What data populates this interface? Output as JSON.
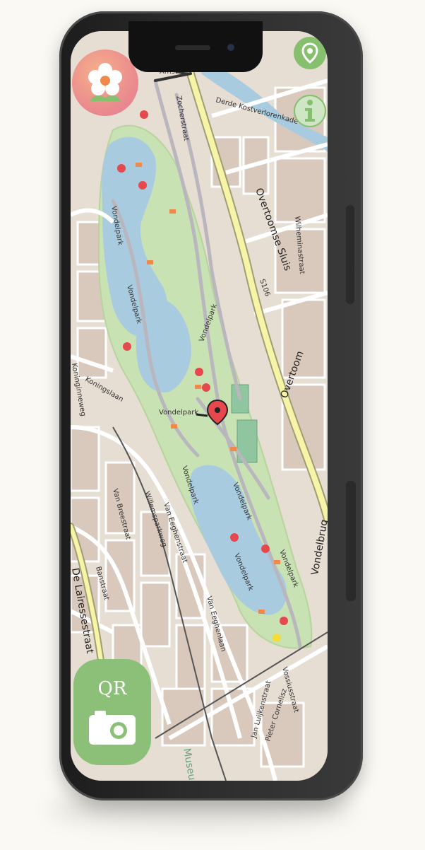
{
  "map": {
    "park_name": "Vondelpark",
    "labels": [
      {
        "text": "Vondelpark"
      },
      {
        "text": "Vondelpark"
      },
      {
        "text": "Vondelpark"
      },
      {
        "text": "Vondelpark"
      },
      {
        "text": "Vondelpark"
      },
      {
        "text": "Vondelpark"
      },
      {
        "text": "Vondelpark"
      },
      {
        "text": "Vondelpark"
      },
      {
        "text": "Zocherstraat"
      },
      {
        "text": "Derde Kostverlorenkade"
      },
      {
        "text": "Overtoomse Sluis"
      },
      {
        "text": "S106"
      },
      {
        "text": "Overtoom"
      },
      {
        "text": "Wilheminastraat"
      },
      {
        "text": "Koninginneweg"
      },
      {
        "text": "Koningslaan"
      },
      {
        "text": "Van Breestraat"
      },
      {
        "text": "Willemsparkweg"
      },
      {
        "text": "Van Eeghenstraat"
      },
      {
        "text": "Van Eeghenlaan"
      },
      {
        "text": "De Lairessestraat"
      },
      {
        "text": "Vossiusstraat"
      },
      {
        "text": "Vondelbrug"
      },
      {
        "text": "Jan Luijkenstraat"
      },
      {
        "text": "Pieter Cornelisz"
      },
      {
        "text": "Banstraat"
      },
      {
        "text": "Museum"
      },
      {
        "text": "Amst"
      }
    ]
  },
  "buttons": {
    "qr_label": "QR"
  },
  "icons": {
    "flower": "flower-icon",
    "pin": "location-pin-icon",
    "info": "info-icon",
    "camera": "camera-icon",
    "current_location": "map-marker-icon"
  },
  "colors": {
    "accent_green": "#86bf6e",
    "qr_green": "#8cc078",
    "marker_red": "#e5484d",
    "marker_orange": "#f08a4b",
    "park_green": "#c9e2b3",
    "water_blue": "#a9cbe0",
    "major_road": "#f7f4a8",
    "phone_frame": "#2b2b2b"
  }
}
